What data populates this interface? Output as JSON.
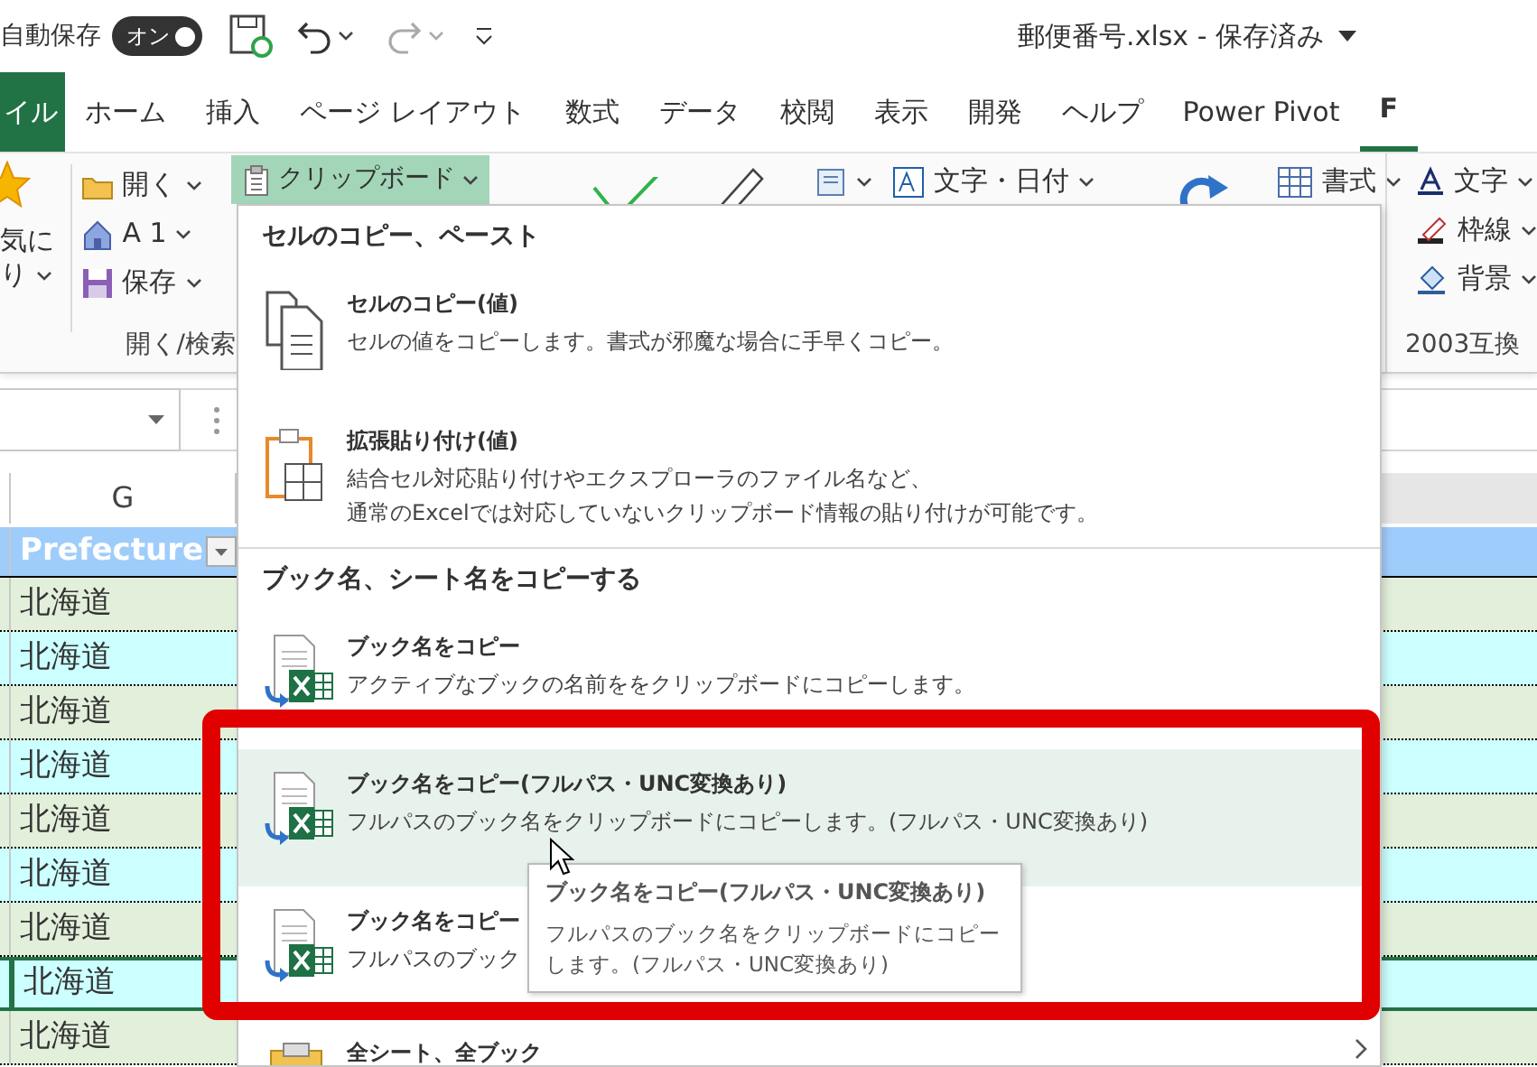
{
  "title_bar": {
    "autosave_label": "自動保存",
    "autosave_toggle": {
      "label": "オン",
      "on": true
    },
    "title": "郵便番号.xlsx - 保存済み"
  },
  "tabs": [
    {
      "label": "イル",
      "kind": "file",
      "selected": false
    },
    {
      "label": "ホーム",
      "kind": "tab",
      "selected": false
    },
    {
      "label": "挿入",
      "kind": "tab",
      "selected": false
    },
    {
      "label": "ページ レイアウト",
      "kind": "tab",
      "selected": false
    },
    {
      "label": "数式",
      "kind": "tab",
      "selected": false
    },
    {
      "label": "データ",
      "kind": "tab",
      "selected": false
    },
    {
      "label": "校閲",
      "kind": "tab",
      "selected": false
    },
    {
      "label": "表示",
      "kind": "tab",
      "selected": false
    },
    {
      "label": "開発",
      "kind": "tab",
      "selected": false
    },
    {
      "label": "ヘルプ",
      "kind": "tab",
      "selected": false
    },
    {
      "label": "Power Pivot",
      "kind": "tab",
      "selected": false
    },
    {
      "label": "F",
      "kind": "tab",
      "selected": true
    }
  ],
  "ribbon": {
    "favorites": {
      "lines": [
        "気に",
        "り"
      ]
    },
    "open_group": {
      "buttons": [
        {
          "label": "開く"
        },
        {
          "label": "A 1"
        },
        {
          "label": "保存"
        }
      ],
      "group_label": "開く/検索"
    },
    "clipboard_button": {
      "label": "クリップボード",
      "expanded": true
    },
    "tools": [
      {
        "label": "文字・日付"
      },
      {
        "label": "書式"
      }
    ],
    "compat_group": {
      "buttons": [
        {
          "label": "文字"
        },
        {
          "label": "枠線"
        },
        {
          "label": "背景"
        }
      ],
      "group_label": "2003互換"
    }
  },
  "sheet": {
    "column_header": "G",
    "header_cell": "Prefecture",
    "rows": [
      {
        "text": "北海道",
        "selected": false
      },
      {
        "text": "北海道",
        "selected": false
      },
      {
        "text": "北海道",
        "selected": false
      },
      {
        "text": "北海道",
        "selected": false
      },
      {
        "text": "北海道",
        "selected": false
      },
      {
        "text": "北海道",
        "selected": false
      },
      {
        "text": "北海道",
        "selected": false
      },
      {
        "text": "北海道",
        "selected": true
      },
      {
        "text": "北海道",
        "selected": false
      }
    ]
  },
  "menu": {
    "sections": [
      {
        "header": "セルのコピー、ペースト",
        "items": [
          {
            "kind": "copy",
            "title": "セルのコピー(値)",
            "description": [
              "セルの値をコピーします。書式が邪魔な場合に手早くコピー。"
            ],
            "highlighted": false,
            "submenu": false
          },
          {
            "kind": "paste",
            "title": "拡張貼り付け(値)",
            "description": [
              "結合セル対応貼り付けやエクスプローラのファイル名など、",
              "通常のExcelでは対応していないクリップボード情報の貼り付けが可能です。"
            ],
            "highlighted": false,
            "submenu": false
          }
        ]
      },
      {
        "header": "ブック名、シート名をコピーする",
        "items": [
          {
            "kind": "book",
            "title": "ブック名をコピー",
            "description": [
              "アクティブなブックの名前ををクリップボードにコピーします。"
            ],
            "highlighted": false,
            "submenu": false
          },
          {
            "kind": "book",
            "title": "ブック名をコピー(フルパス・UNC変換あり)",
            "description": [
              "フルパスのブック名をクリップボードにコピーします。(フルパス・UNC変換あり)"
            ],
            "highlighted": true,
            "submenu": false
          },
          {
            "kind": "book",
            "title": "ブック名をコピー",
            "description": [
              "フルパスのブック"
            ],
            "highlighted": false,
            "submenu": false
          },
          {
            "kind": "clipboard",
            "title": "全シート、全ブック",
            "highlighted": false,
            "submenu": true
          }
        ]
      }
    ]
  },
  "tooltip": {
    "title": "ブック名をコピー(フルパス・UNC変換あり)",
    "description": "フルパスのブック名をクリップボードにコピーします。(フルパス・UNC変換あり)"
  },
  "highlight_frame": true,
  "mouse_cursor": true
}
